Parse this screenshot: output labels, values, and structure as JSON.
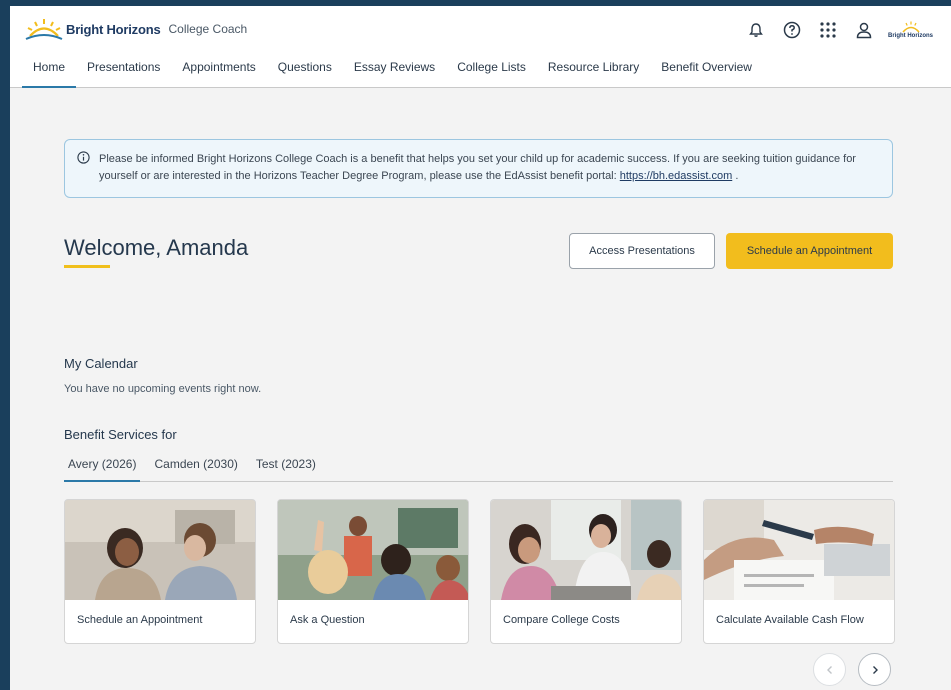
{
  "brand": {
    "name": "Bright Horizons",
    "product": "College Coach",
    "small_logo_text": "Bright Horizons"
  },
  "icons": {
    "notifications": "bell-icon",
    "help": "help-circle-icon",
    "apps": "grid-icon",
    "profile": "user-icon"
  },
  "nav": {
    "tabs": [
      {
        "label": "Home",
        "active": true
      },
      {
        "label": "Presentations"
      },
      {
        "label": "Appointments"
      },
      {
        "label": "Questions"
      },
      {
        "label": "Essay Reviews"
      },
      {
        "label": "College Lists"
      },
      {
        "label": "Resource Library"
      },
      {
        "label": "Benefit Overview"
      }
    ]
  },
  "notice": {
    "text": "Please be informed Bright Horizons College Coach is a benefit that helps you set your child up for academic success. If you are seeking tuition guidance for yourself or are interested in the Horizons Teacher Degree Program, please use the EdAssist benefit portal:",
    "link": "https://bh.edassist.com",
    "suffix": "."
  },
  "welcome": "Welcome, Amanda",
  "actions": {
    "access_presentations": "Access Presentations",
    "schedule_appointment": "Schedule an Appointment"
  },
  "calendar": {
    "title": "My Calendar",
    "empty": "You have no upcoming events right now."
  },
  "benefits": {
    "title": "Benefit Services for",
    "kids": [
      {
        "label": "Avery (2026)",
        "active": true
      },
      {
        "label": "Camden (2030)"
      },
      {
        "label": "Test (2023)"
      }
    ],
    "cards": [
      {
        "label": "Schedule an Appointment"
      },
      {
        "label": "Ask a Question"
      },
      {
        "label": "Compare College Costs"
      },
      {
        "label": "Calculate Available Cash Flow"
      }
    ]
  },
  "colors": {
    "accent": "#f2bd1d",
    "link_blue": "#2b79a8",
    "navy": "#1f3b63"
  }
}
